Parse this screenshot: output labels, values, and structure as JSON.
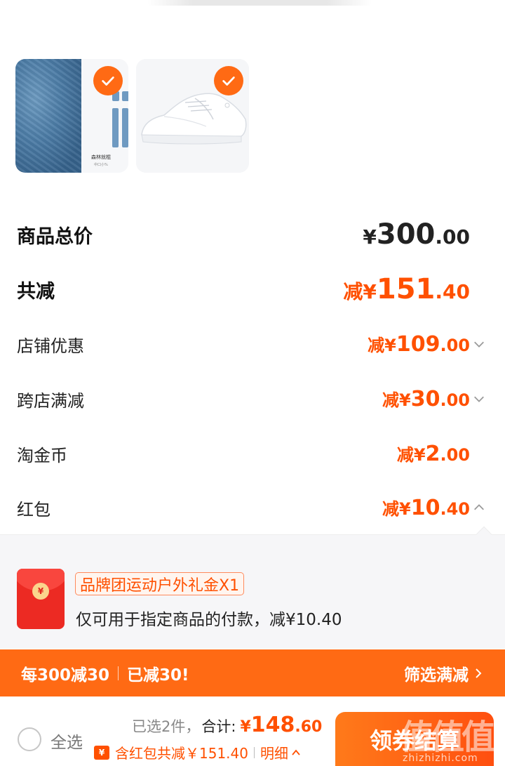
{
  "products": [
    {
      "name": "jeans",
      "selected": true,
      "caption": "森林就棍",
      "sub": "中口小%"
    },
    {
      "name": "white-sneaker",
      "selected": true
    }
  ],
  "summary_rows": {
    "total_label": "商品总价",
    "total_price": {
      "symbol": "¥",
      "int": "300",
      "dec": ".00"
    },
    "reduce_label": "共减",
    "reduce_price": {
      "prefix": "减¥",
      "int": "151",
      "dec": ".40"
    },
    "shop_label": "店铺优惠",
    "shop_price": {
      "prefix": "减¥",
      "int": "109",
      "dec": ".00"
    },
    "cross_label": "跨店满减",
    "cross_price": {
      "prefix": "减¥",
      "int": "30",
      "dec": ".00"
    },
    "coin_label": "淘金币",
    "coin_price": {
      "prefix": "减¥",
      "int": "2",
      "dec": ".00"
    },
    "hongbao_label": "红包",
    "hongbao_price": {
      "prefix": "减¥",
      "int": "10",
      "dec": ".40"
    }
  },
  "hongbao_panel": {
    "coin_symbol": "¥",
    "tag": "品牌团运动户外礼金X1",
    "desc": "仅可用于指定商品的付款，减¥10.40"
  },
  "banner": {
    "left_a": "每300减30",
    "left_b": "已减30!",
    "right": "筛选满减"
  },
  "bottom": {
    "select_all": "全选",
    "count": "已选2件，",
    "total_label": "合计:",
    "total": {
      "symbol": "¥",
      "int": "148",
      "dec": ".60"
    },
    "ticket": "¥",
    "discount": "含红包共减￥151.40",
    "detail": "明细",
    "checkout": "领券结算"
  },
  "watermark": {
    "big": "值值值",
    "small": "zhizhizhi.com"
  },
  "colors": {
    "accent": "#ff5000",
    "banner": "#ff6a14",
    "check": "#ff6a14"
  }
}
